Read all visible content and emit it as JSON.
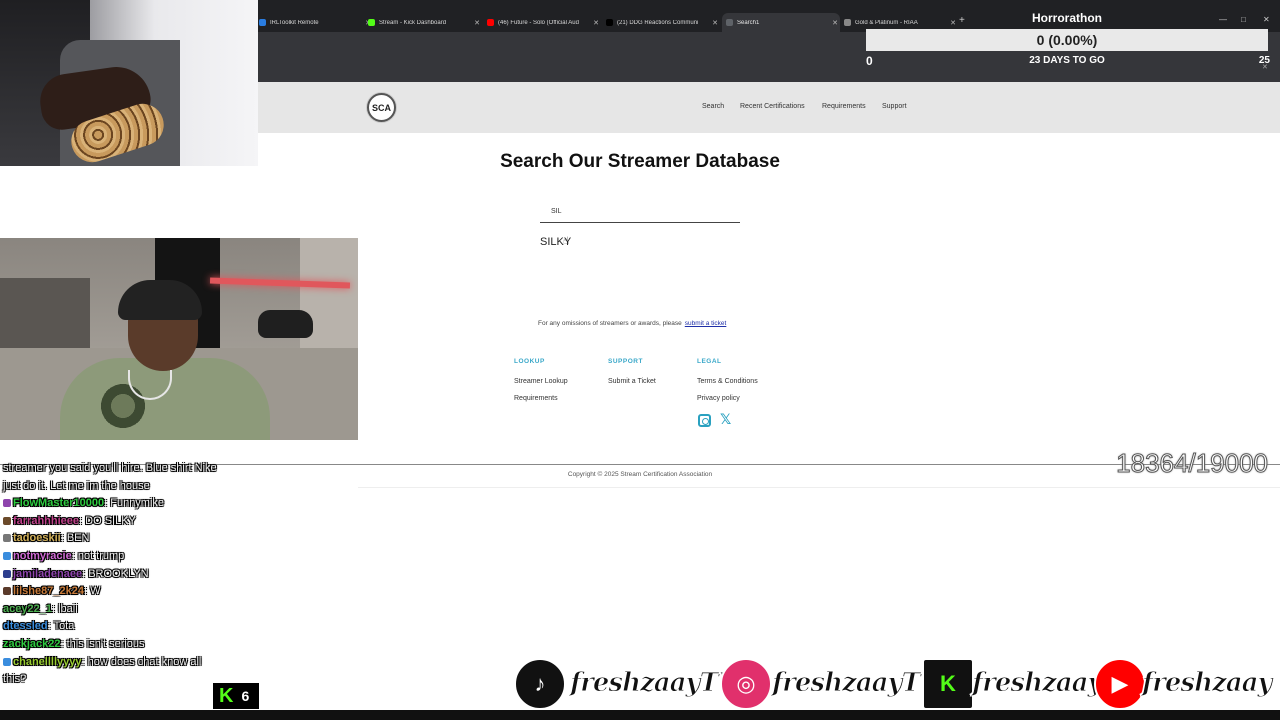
{
  "browser": {
    "tabs": [
      {
        "label": "IRLToolkit Remote",
        "active": false,
        "favicon_color": "#2a7de1"
      },
      {
        "label": "Stream - Kick Dashboard",
        "active": false,
        "favicon_color": "#53fc18"
      },
      {
        "label": "(46) Future - Solo (Official Aud",
        "active": false,
        "favicon_color": "#ff0000"
      },
      {
        "label": "(21) DDG Reactions Communi",
        "active": false,
        "favicon_color": "#000000"
      },
      {
        "label": "Search1",
        "active": true,
        "favicon_color": "#5f6368"
      },
      {
        "label": "Gold & Platinum - RIAA",
        "active": false,
        "favicon_color": "#888888"
      }
    ],
    "new_tab_icon": "+",
    "window_controls": [
      "—",
      "□",
      "✕"
    ]
  },
  "goal": {
    "title": "Horrorathon",
    "value_text": "0 (0.00%)",
    "progress": 0.0,
    "min": "0",
    "days_text": "23 DAYS TO GO",
    "max": "25",
    "close_icon": "✕"
  },
  "site": {
    "logo_text": "SCA",
    "nav": [
      "Search",
      "Recent Certifications",
      "Requirements",
      "Support"
    ],
    "title": "Search Our Streamer Database",
    "search_value": "SIL",
    "suggestion": "SILKY",
    "omission_text": "For any omissions of streamers or awards, please",
    "omission_link": "submit a ticket",
    "footer": {
      "lookup_heading": "LOOKUP",
      "lookup_links": [
        "Streamer Lookup",
        "Requirements"
      ],
      "support_heading": "SUPPORT",
      "support_links": [
        "Submit a Ticket"
      ],
      "legal_heading": "LEGAL",
      "legal_links": [
        "Terms & Conditions",
        "Privacy policy"
      ],
      "social_icons": [
        "instagram-icon",
        "x-icon"
      ]
    },
    "copyright": "Copyright © 2025 Stream Certification Association"
  },
  "chat": [
    {
      "user": "",
      "text": "streamer you said you'll hire. Blue shirt Nike just do it. Let me im the house",
      "color": "#ffffff",
      "badge": ""
    },
    {
      "user": "FlowMaster10000",
      "text": "Funnymike",
      "color": "#2ecc40",
      "badge": "#8e44ad"
    },
    {
      "user": "farrahhhieee",
      "text": "DO SILKY",
      "color": "#c0418b",
      "badge": "#6b4a2a"
    },
    {
      "user": "tadoeskii",
      "text": "BEN",
      "color": "#d4b25a",
      "badge": "#777777"
    },
    {
      "user": "notmyracie",
      "text": "not trump",
      "color": "#d16bd6",
      "badge": "#3a8dde"
    },
    {
      "user": "jamiladenaee",
      "text": "BROOKLYN",
      "color": "#8e44ad",
      "badge": "#2c3e8e"
    },
    {
      "user": "lilshe87_2k24",
      "text": "W",
      "color": "#c97b3a",
      "badge": "#5a3a2a"
    },
    {
      "user": "acey22_1",
      "text": "lbaii",
      "color": "#4caf50",
      "badge": ""
    },
    {
      "user": "dtessled",
      "text": "Tota",
      "color": "#3a8dde",
      "badge": ""
    },
    {
      "user": "zackjack22",
      "text": "this isn't serious",
      "color": "#2ecc40",
      "badge": ""
    },
    {
      "user": "chanellllyyyy",
      "text": "how does chat know all this?",
      "color": "#9acd32",
      "badge": "#3a8dde"
    }
  ],
  "viewer_count": "6",
  "sub_counter": "18364/19000",
  "socials": [
    {
      "platform": "tiktok",
      "handle": "freshzaayTV",
      "color": "#111111",
      "glyph": "♪"
    },
    {
      "platform": "instagram",
      "handle": "freshzaayTV",
      "color": "#e1306c",
      "glyph": "◎"
    },
    {
      "platform": "kick",
      "handle": "freshzaay",
      "color": "#111111",
      "glyph": "K"
    },
    {
      "platform": "youtube",
      "handle": "freshzaay",
      "color": "#ff0000",
      "glyph": "▶"
    }
  ]
}
